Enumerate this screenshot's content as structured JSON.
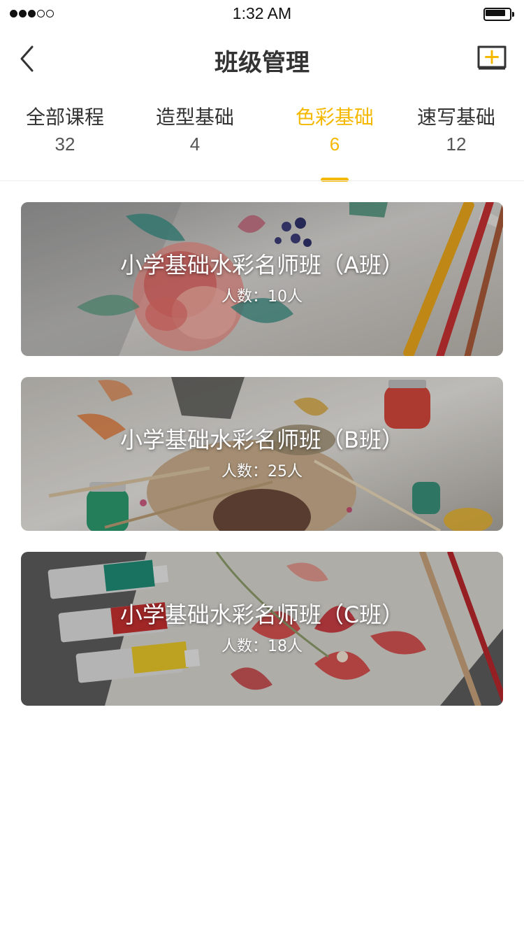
{
  "status_bar": {
    "time": "1:32 AM",
    "signal_filled": 3,
    "signal_total": 5,
    "battery_level": 0.8
  },
  "nav": {
    "title": "班级管理",
    "back_icon": "chevron-left-icon",
    "add_icon": "add-square-icon"
  },
  "tabs": [
    {
      "label": "全部课程",
      "count": "32"
    },
    {
      "label": "造型基础",
      "count": "4"
    },
    {
      "label": "色彩基础",
      "count": "6"
    },
    {
      "label": "速写基础",
      "count": "12"
    }
  ],
  "active_tab_index": 2,
  "colors": {
    "accent": "#f5b800",
    "text": "#333333",
    "background": "#ffffff"
  },
  "classes": [
    {
      "name": "小学基础水彩名师班（A班）",
      "count": "人数：10人",
      "image": "watercolor-rose-painting"
    },
    {
      "name": "小学基础水彩名师班（B班）",
      "count": "人数：25人",
      "image": "paint-palette-jars"
    },
    {
      "name": "小学基础水彩名师班（C班）",
      "count": "人数：18人",
      "image": "paint-tubes-red-flowers"
    }
  ]
}
